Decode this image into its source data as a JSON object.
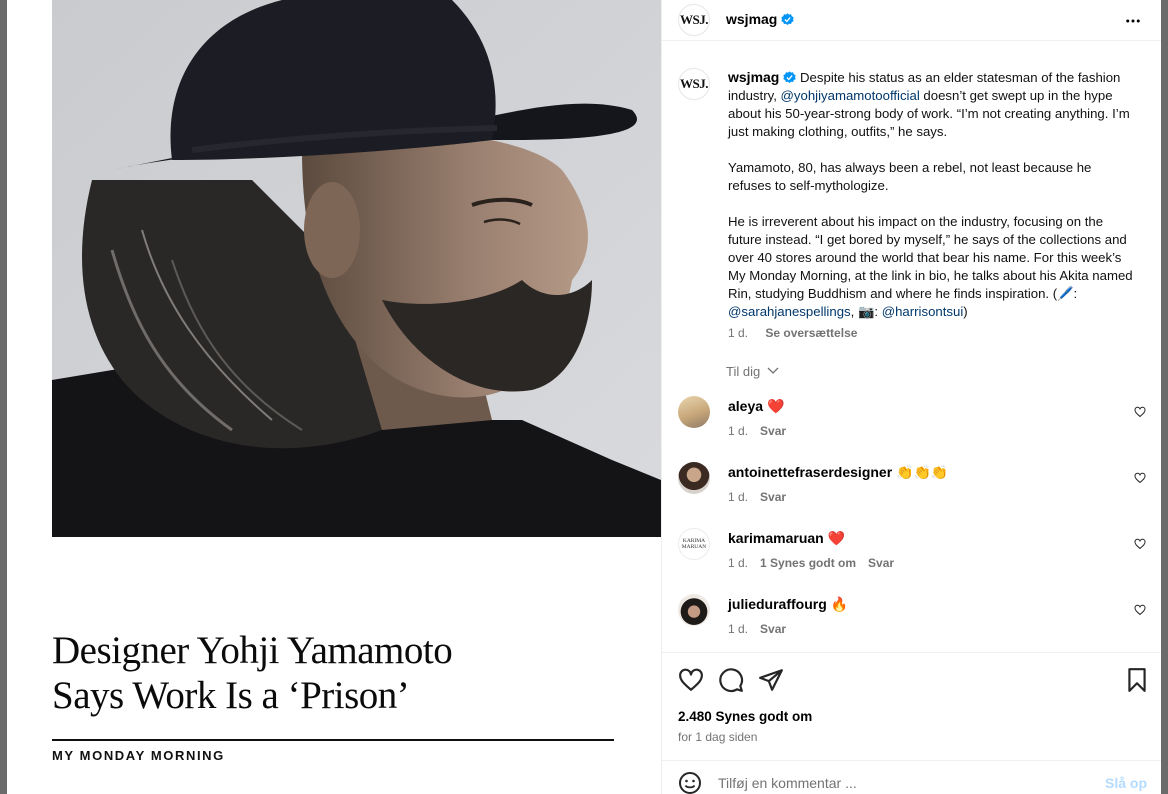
{
  "media": {
    "headline_line1": "Designer Yohji Yamamoto",
    "headline_line2": "Says Work Is a ‘Prison’",
    "kicker": "MY MONDAY MORNING"
  },
  "post": {
    "author": "wsjmag",
    "author_logo": "WSJ.",
    "caption": {
      "p1_a": "Despite his status as an elder statesman of the fashion industry, ",
      "p1_link": "@yohjiyamamotoofficial",
      "p1_b": " doesn’t get swept up in the hype about his 50-year-strong body of work. “I’m not creating anything. I’m just making clothing, outfits,” he says.",
      "p2": "Yamamoto, 80, has always been a rebel, not least because he refuses to self-mythologize.",
      "p3_a": "He is irreverent about his impact on the industry, focusing on the future instead. “I get bored by myself,” he says of the collections and over 40 stores around the world that bear his name. For this week’s My Monday Morning, at the link in bio, he talks about his Akita named Rin, studying Buddhism and where he finds inspiration. (🖊️: ",
      "p3_link1": "@sarahjanespellings",
      "p3_b": ", 📷: ",
      "p3_link2": "@harrisontsui",
      "p3_c": ")",
      "time": "1 d.",
      "translate": "Se oversættelse"
    },
    "filter_label": "Til dig",
    "comments": [
      {
        "user": "aleya",
        "text": "❤️",
        "time": "1 d.",
        "likes": "",
        "reply": "Svar"
      },
      {
        "user": "antoinettefraserdesigner",
        "text": "👏👏👏",
        "time": "1 d.",
        "likes": "",
        "reply": "Svar"
      },
      {
        "user": "karimamaruan",
        "text": "❤️",
        "time": "1 d.",
        "likes": "1 Synes godt om",
        "reply": "Svar",
        "avatar_text": "KARIMA MARUAN"
      },
      {
        "user": "julieduraffourg",
        "text": "🔥",
        "time": "1 d.",
        "likes": "",
        "reply": "Svar"
      }
    ],
    "likes_count": "2.480 Synes godt om",
    "time_ago": "for 1 dag siden",
    "comment_placeholder": "Tilføj en kommentar ...",
    "post_label": "Slå op"
  },
  "colors": {
    "verified": "#0095f6",
    "link": "#00376b",
    "heart_red": "#ff3040",
    "post_button_disabled": "#b3dbff"
  }
}
